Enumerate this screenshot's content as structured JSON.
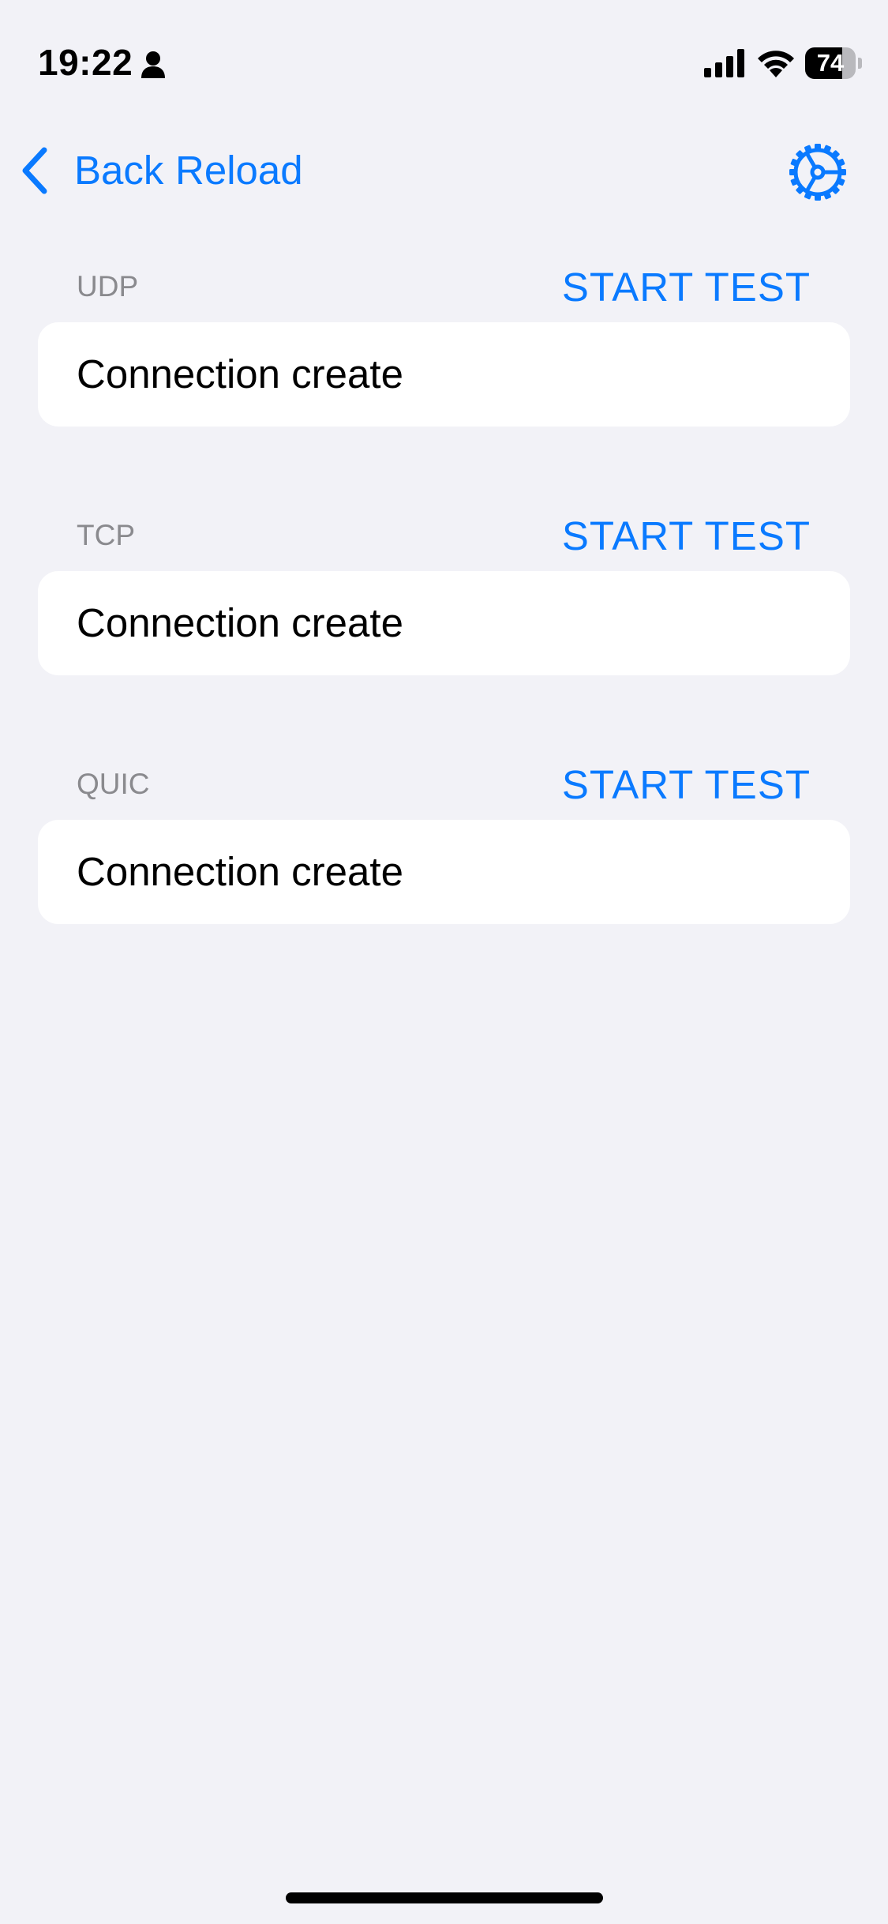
{
  "status_bar": {
    "time": "19:22",
    "battery_level": "74",
    "battery_fraction": 0.74,
    "icons": [
      "person-icon",
      "signal-icon",
      "wifi-icon",
      "battery-icon"
    ]
  },
  "nav": {
    "back_label": "Back",
    "reload_label": "Reload",
    "settings_icon": "gear-icon"
  },
  "colors": {
    "accent": "#0a7aff",
    "background": "#f2f2f7",
    "card": "#ffffff",
    "section_header": "#8a8a8e"
  },
  "sections": [
    {
      "header": "UDP",
      "action": "START TEST",
      "row": "Connection create"
    },
    {
      "header": "TCP",
      "action": "START TEST",
      "row": "Connection create"
    },
    {
      "header": "QUIC",
      "action": "START TEST",
      "row": "Connection create"
    }
  ]
}
